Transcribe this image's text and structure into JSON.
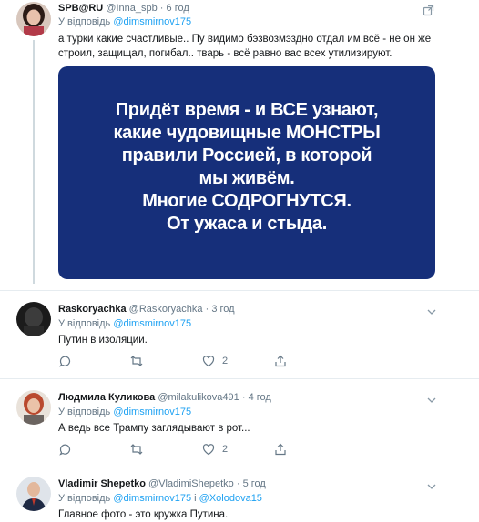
{
  "tweets": [
    {
      "name": "SPB@RU",
      "handle": "@Inna_spb",
      "time": "6 год",
      "reply_prefix": "У відповідь",
      "reply_to": "@dimsmirnov175",
      "text": "а турки какие счастливые.. Пу видимо бэзвозмэздно отдал им всё - не он же строил, защищал, погибал.. тварь - всё равно вас всех утилизируют.",
      "image_text": [
        "Придёт время - и ВСЕ узнают,",
        "какие чудовищные МОНСТРЫ",
        "правили Россией, в которой",
        "мы живём.",
        "Многие СОДРОГНУТСЯ.",
        "От ужаса и стыда."
      ]
    },
    {
      "name": "Raskoryachka",
      "handle": "@Raskoryachka",
      "time": "3 год",
      "reply_prefix": "У відповідь",
      "reply_to": "@dimsmirnov175",
      "text": "Путин в изоляции.",
      "likes": "2"
    },
    {
      "name": "Людмила Куликова",
      "handle": "@milakulikova491",
      "time": "4 год",
      "reply_prefix": "У відповідь",
      "reply_to": "@dimsmirnov175",
      "text": "А ведь все Трампу заглядывают в рот...",
      "likes": "2"
    },
    {
      "name": "Vladimir Shepetko",
      "handle": "@VladimiShepetko",
      "time": "5 год",
      "reply_prefix": "У відповідь",
      "reply_to": "@dimsmirnov175",
      "conj": "і",
      "reply_to_2": "@Xolodova15",
      "text": "Главное фото - это кружка Путина."
    }
  ],
  "separator": "·"
}
